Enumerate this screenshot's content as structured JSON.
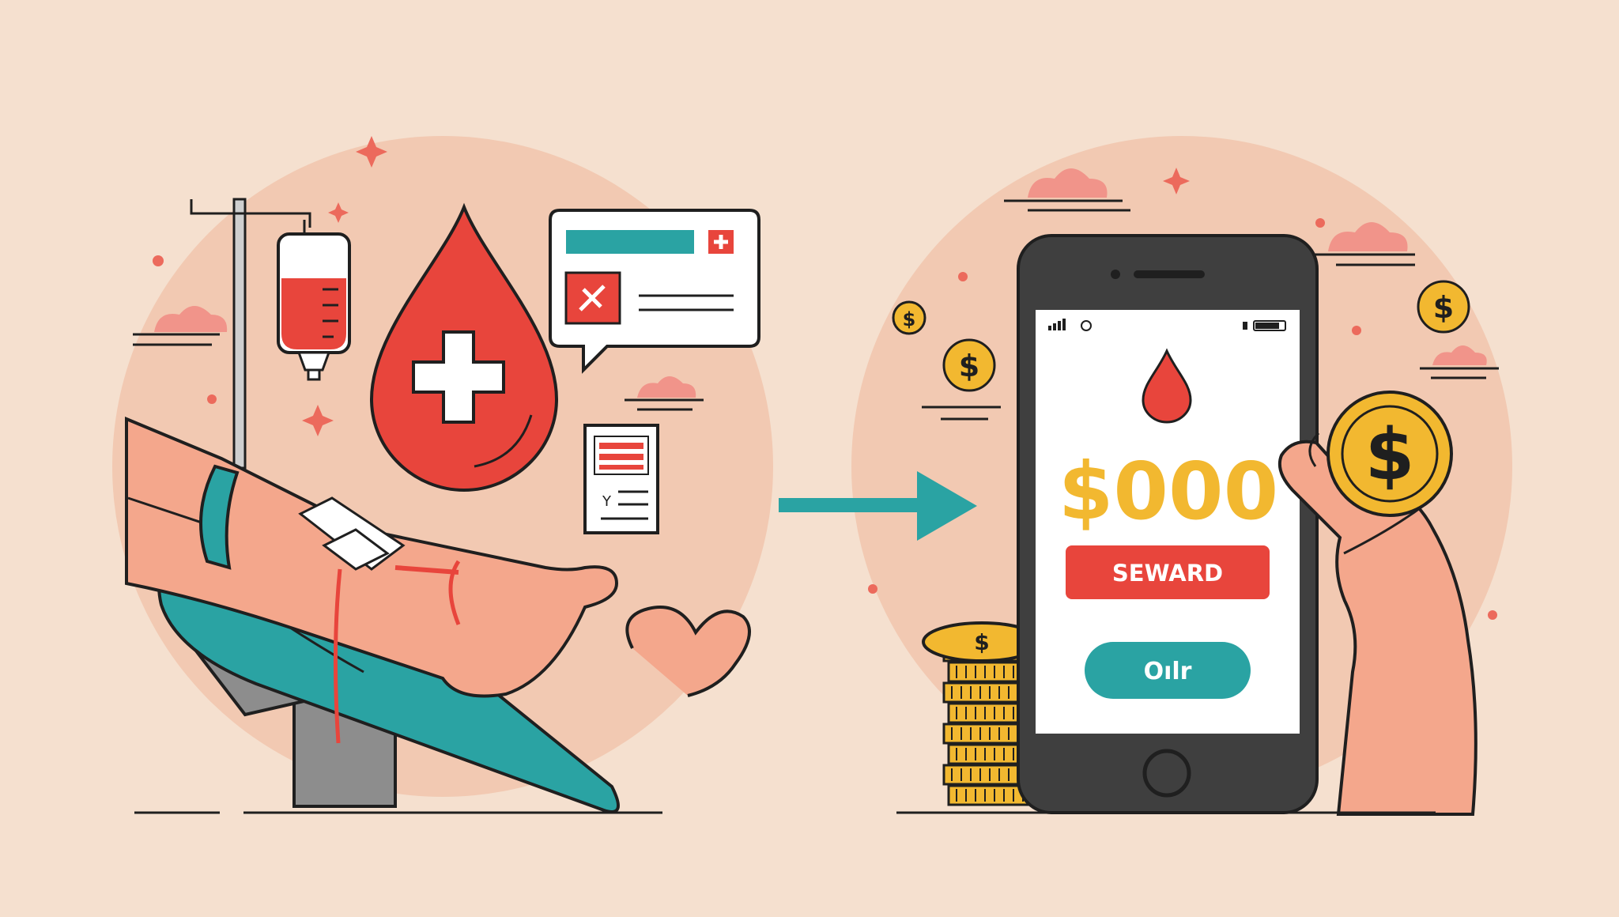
{
  "colors": {
    "background": "#f5e0cf",
    "circle": "#f0c2a8",
    "blood_red": "#e8453c",
    "teal": "#2aa3a3",
    "gold": "#f2b830",
    "phone_body": "#3f3f3f",
    "skin": "#f4a78c",
    "outline": "#1f1f1f"
  },
  "left_scene": {
    "items": [
      "iv-pole",
      "blood-bag",
      "blood-drop-with-cross",
      "chat-card",
      "document",
      "arm-with-iv",
      "donation-chair"
    ],
    "document_mark": "Y"
  },
  "arrow": {
    "direction": "right",
    "color": "#2aa3a3"
  },
  "phone": {
    "amount": "$000",
    "reward_label": "SEWARD",
    "secondary_button_label": "Oılr"
  },
  "coins": {
    "symbol": "$",
    "stack_count": 8
  }
}
